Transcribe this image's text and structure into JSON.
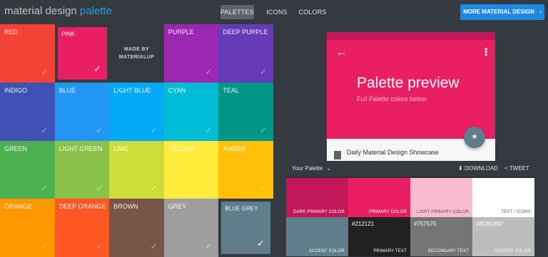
{
  "header": {
    "logo_main": "material design",
    "logo_accent": "palette",
    "nav": [
      {
        "label": "PALETTES",
        "active": true
      },
      {
        "label": "ICONS",
        "active": false
      },
      {
        "label": "COLORS",
        "active": false
      }
    ],
    "cta_label": "MORE MATERIAL DESIGN",
    "cta_arrow": "›"
  },
  "tiles": [
    {
      "name": "RED",
      "color": "#f44336",
      "selected": false
    },
    {
      "name": "PINK",
      "color": "#e91e63",
      "selected": true
    },
    {
      "name": "",
      "color": "",
      "selected": false,
      "madeby": true
    },
    {
      "name": "PURPLE",
      "color": "#9c27b0",
      "selected": false
    },
    {
      "name": "DEEP PURPLE",
      "color": "#673ab7",
      "selected": false
    },
    {
      "name": "INDIGO",
      "color": "#3f51b5",
      "selected": false
    },
    {
      "name": "BLUE",
      "color": "#2196f3",
      "selected": false
    },
    {
      "name": "LIGHT BLUE",
      "color": "#03a9f4",
      "selected": false
    },
    {
      "name": "CYAN",
      "color": "#00bcd4",
      "selected": false
    },
    {
      "name": "TEAL",
      "color": "#009688",
      "selected": false
    },
    {
      "name": "GREEN",
      "color": "#4caf50",
      "selected": false
    },
    {
      "name": "LIGHT GREEN",
      "color": "#8bc34a",
      "selected": false
    },
    {
      "name": "LIME",
      "color": "#cddc39",
      "selected": false
    },
    {
      "name": "YELLOW",
      "color": "#ffeb3b",
      "selected": false
    },
    {
      "name": "AMBER",
      "color": "#ffc107",
      "selected": false
    },
    {
      "name": "ORANGE",
      "color": "#ff9800",
      "selected": false
    },
    {
      "name": "DEEP ORANGE",
      "color": "#ff5722",
      "selected": false
    },
    {
      "name": "BROWN",
      "color": "#795548",
      "selected": false
    },
    {
      "name": "GREY",
      "color": "#9e9e9e",
      "selected": false
    },
    {
      "name": "BLUE GREY",
      "color": "#607d8b",
      "selected": true
    }
  ],
  "madeby": {
    "line1": "MADE BY",
    "line2": "MATERIALUP"
  },
  "check_glyph": "✓",
  "preview": {
    "back_icon": "←",
    "menu_icon": "⋮",
    "title": "Palette preview",
    "subtitle": "Full Palette colors below",
    "fab_icon": "★",
    "showcase": "Daily Material Design Showcase",
    "primary": "#e91e63",
    "primary_dark": "#c2185b",
    "accent": "#607d8b"
  },
  "palette_panel": {
    "title": "Your Palette",
    "title_caret": "⌄",
    "download_label": "DOWNLOAD",
    "download_icon": "⬇",
    "tweet_label": "TWEET",
    "tweet_icon": "<",
    "swatches": [
      {
        "role": "DARK PRIMARY COLOR",
        "hex": "",
        "bg": "#c2185b",
        "fg": "#ffffff"
      },
      {
        "role": "PRIMARY COLOR",
        "hex": "",
        "bg": "#e91e63",
        "fg": "#ffffff"
      },
      {
        "role": "LIGHT PRIMARY COLOR",
        "hex": "",
        "bg": "#f8bbd0",
        "fg": "#555555"
      },
      {
        "role": "TEXT / ICONS",
        "hex": "",
        "bg": "#ffffff",
        "fg": "#555555"
      },
      {
        "role": "ACCENT COLOR",
        "hex": "",
        "bg": "#607d8b",
        "fg": "#ffffff"
      },
      {
        "role": "PRIMARY TEXT",
        "hex": "#212121",
        "bg": "#212121",
        "fg": "#ffffff"
      },
      {
        "role": "SECONDARY TEXT",
        "hex": "#757575",
        "bg": "#757575",
        "fg": "#ffffff"
      },
      {
        "role": "DIVIDER COLOR",
        "hex": "#BDBDBD",
        "bg": "#bdbdbd",
        "fg": "#ffffff"
      }
    ]
  }
}
